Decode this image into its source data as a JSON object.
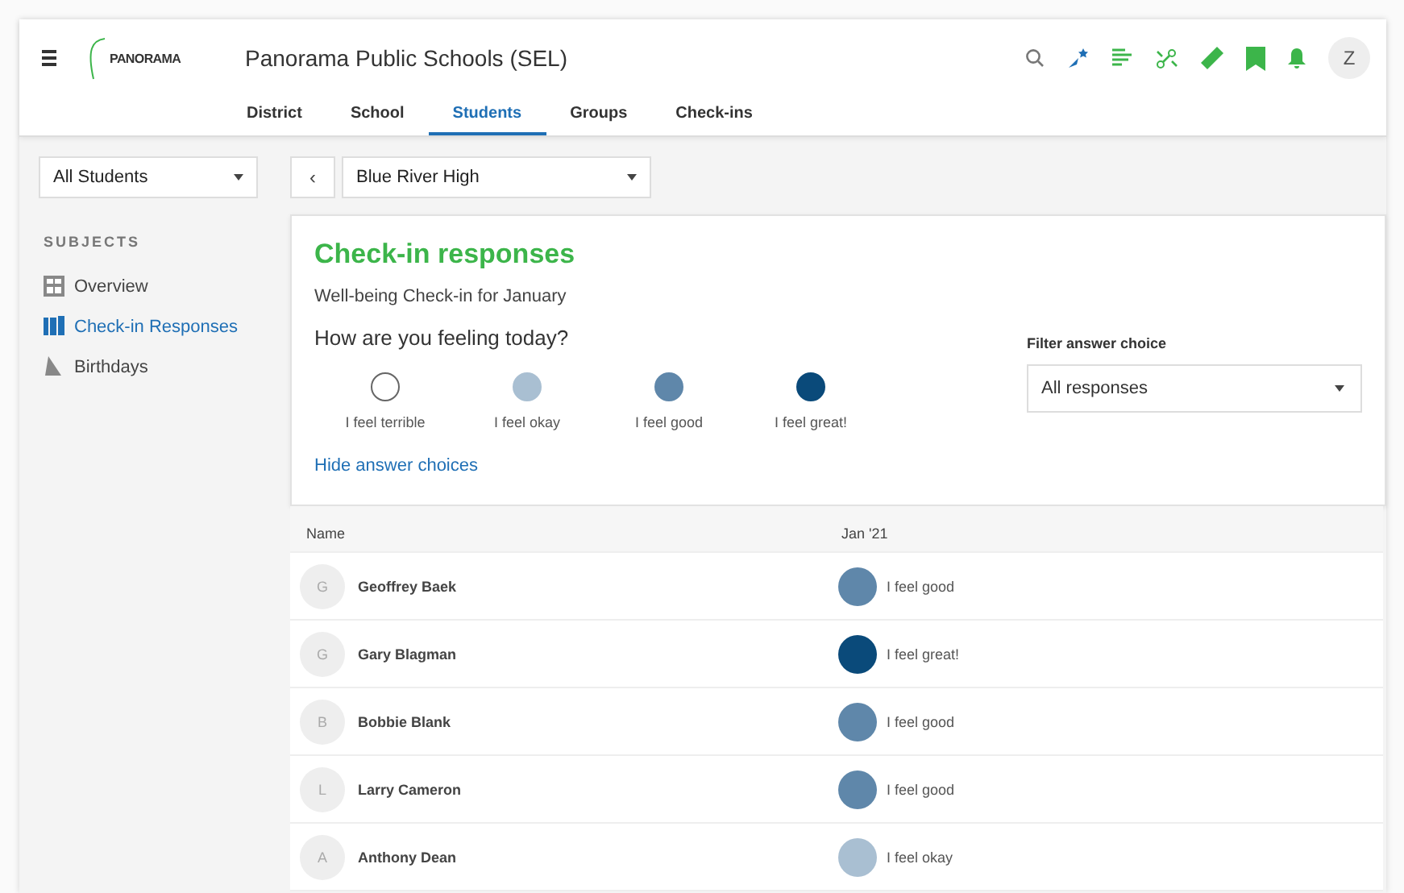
{
  "header": {
    "logo": "PANORAMA",
    "title": "Panorama Public Schools (SEL)",
    "avatar": "Z"
  },
  "tabs": [
    {
      "label": "District",
      "selected": false
    },
    {
      "label": "School",
      "selected": false
    },
    {
      "label": "Students",
      "selected": true
    },
    {
      "label": "Groups",
      "selected": false
    },
    {
      "label": "Check-ins",
      "selected": false
    }
  ],
  "sidebar": {
    "dropdown": "All Students",
    "heading": "SUBJECTS",
    "items": [
      {
        "label": "Overview",
        "kind": "grid",
        "selected": false
      },
      {
        "label": "Check-in Responses",
        "kind": "book",
        "selected": true
      },
      {
        "label": "Birthdays",
        "kind": "party",
        "selected": false
      }
    ]
  },
  "school_select": {
    "back": "‹",
    "value": "Blue River High"
  },
  "card": {
    "title": "Check-in responses",
    "subtitle": "Well-being Check-in for January",
    "question": "How are you feeling today?",
    "choices": [
      {
        "label": "I feel terrible",
        "color": "#ffffff"
      },
      {
        "label": "I feel okay",
        "color": "#a9bfd2"
      },
      {
        "label": "I feel good",
        "color": "#5f87aa"
      },
      {
        "label": "I feel great!",
        "color": "#0a4a7a"
      }
    ],
    "hide_link": "Hide answer choices",
    "filter_label": "Filter answer choice",
    "filter_value": "All responses"
  },
  "table": {
    "columns": [
      "Name",
      "Jan '21"
    ],
    "rows": [
      {
        "initial": "G",
        "name": "Geoffrey Baek",
        "response": "I feel good",
        "color": "#5f87aa"
      },
      {
        "initial": "G",
        "name": "Gary Blagman",
        "response": "I feel great!",
        "color": "#0a4a7a"
      },
      {
        "initial": "B",
        "name": "Bobbie Blank",
        "response": "I feel good",
        "color": "#5f87aa"
      },
      {
        "initial": "L",
        "name": "Larry Cameron",
        "response": "I feel good",
        "color": "#5f87aa"
      },
      {
        "initial": "A",
        "name": "Anthony Dean",
        "response": "I feel okay",
        "color": "#a9bfd2"
      }
    ]
  }
}
